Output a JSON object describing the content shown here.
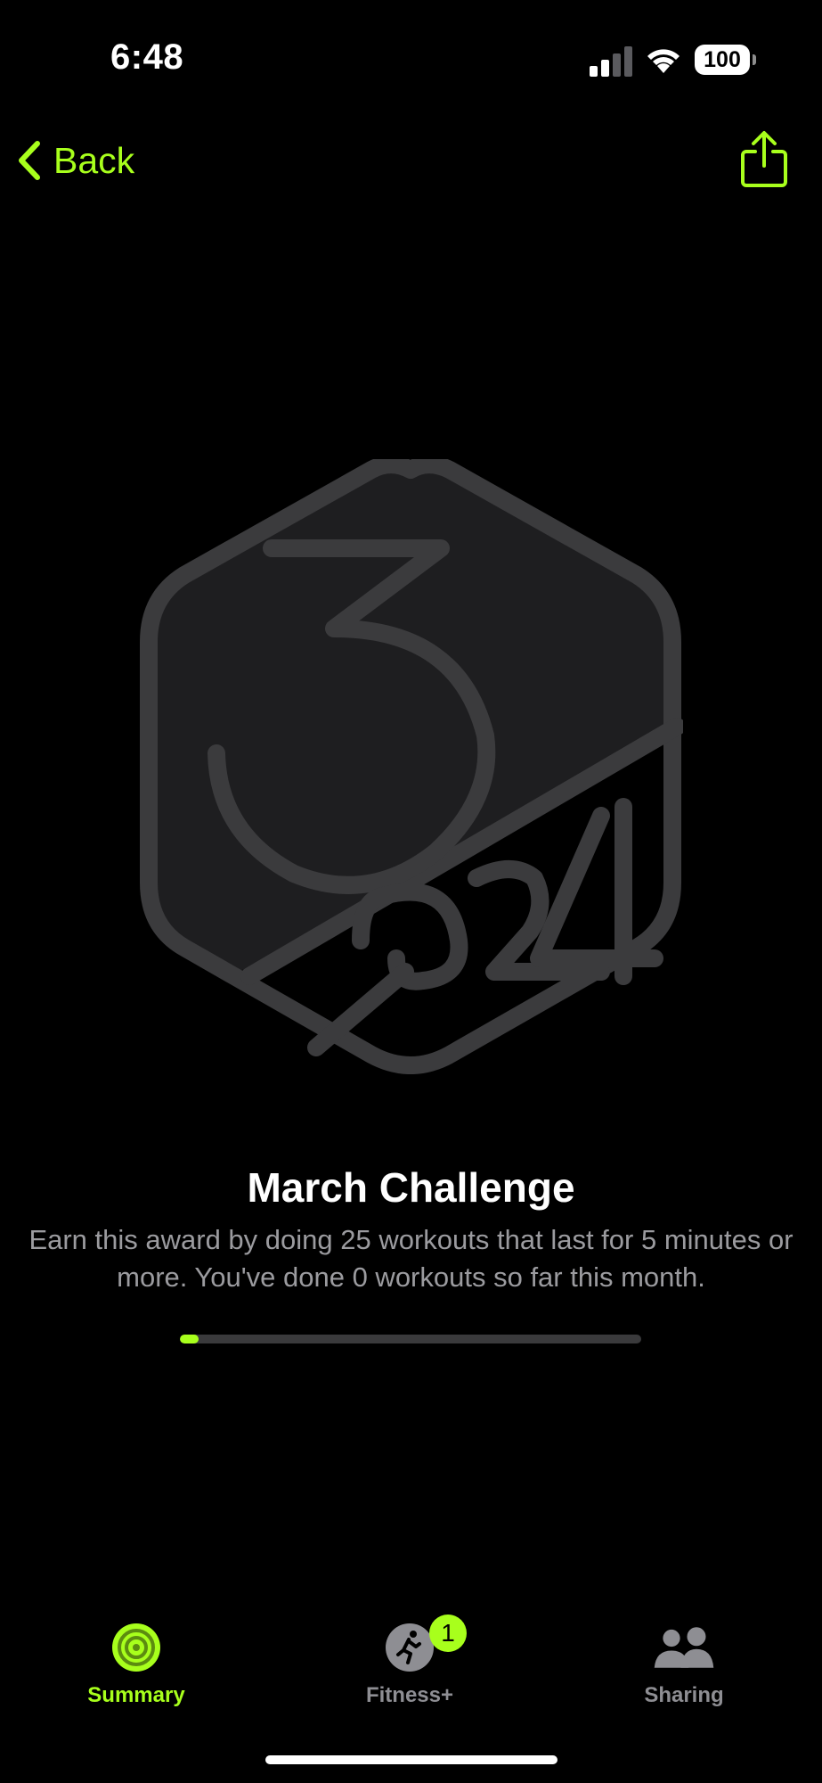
{
  "status_bar": {
    "time": "6:48",
    "battery_level": "100"
  },
  "nav": {
    "back_label": "Back",
    "share_icon": "share-icon"
  },
  "award": {
    "badge_icon": "march-2024-challenge-badge",
    "title": "March Challenge",
    "description": "Earn this award by doing 25 workouts that last for 5 minutes or more. You've done 0 workouts so far this month.",
    "progress_fraction": 0.04
  },
  "tab_bar": {
    "tabs": [
      {
        "label": "Summary",
        "icon": "activity-rings-icon",
        "selected": true
      },
      {
        "label": "Fitness+",
        "icon": "fitness-plus-icon",
        "badge": "1"
      },
      {
        "label": "Sharing",
        "icon": "people-icon"
      }
    ]
  },
  "colors": {
    "accent": "#a8ff1c",
    "background": "#000000",
    "secondary_text": "#9b9b9f",
    "badge_stroke": "#3b3b3d",
    "badge_fill": "#1e1e20"
  }
}
